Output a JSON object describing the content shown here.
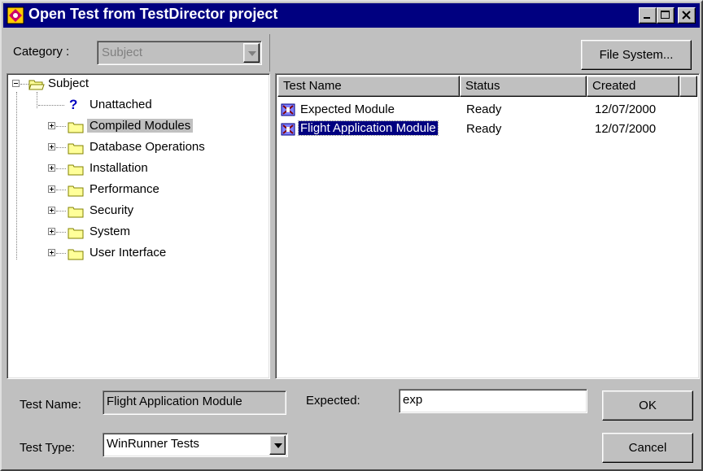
{
  "window": {
    "title": "Open Test from TestDirector project",
    "controls": [
      "minimize",
      "maximize",
      "close"
    ]
  },
  "category": {
    "label": "Category :",
    "value": "Subject",
    "enabled": false
  },
  "file_system_button": "File System...",
  "tree": {
    "root": "Subject",
    "items": [
      {
        "label": "Unattached",
        "icon": "question-mark-icon",
        "expandable": false,
        "selected": false
      },
      {
        "label": "Compiled Modules",
        "icon": "folder-icon",
        "expandable": true,
        "selected": true
      },
      {
        "label": "Database Operations",
        "icon": "folder-icon",
        "expandable": true,
        "selected": false
      },
      {
        "label": "Installation",
        "icon": "folder-icon",
        "expandable": true,
        "selected": false
      },
      {
        "label": "Performance",
        "icon": "folder-icon",
        "expandable": true,
        "selected": false
      },
      {
        "label": "Security",
        "icon": "folder-icon",
        "expandable": true,
        "selected": false
      },
      {
        "label": "System",
        "icon": "folder-icon",
        "expandable": true,
        "selected": false
      },
      {
        "label": "User Interface",
        "icon": "folder-icon",
        "expandable": true,
        "selected": false
      }
    ]
  },
  "test_list": {
    "columns": [
      "Test Name",
      "Status",
      "Created"
    ],
    "rows": [
      {
        "name": "Expected Module",
        "status": "Ready",
        "created": "12/07/2000",
        "selected": false
      },
      {
        "name": "Flight Application Module",
        "status": "Ready",
        "created": "12/07/2000",
        "selected": true
      }
    ]
  },
  "bottom": {
    "test_name_label": "Test Name:",
    "test_name_value": "Flight Application Module",
    "expected_label": "Expected:",
    "expected_value": "exp",
    "test_type_label": "Test Type:",
    "test_type_value": "WinRunner Tests",
    "ok_label": "OK",
    "cancel_label": "Cancel"
  },
  "colors": {
    "titlebar": "#000080",
    "face": "#c0c0c0",
    "selection": "#000080",
    "folder": "#ffff99"
  }
}
